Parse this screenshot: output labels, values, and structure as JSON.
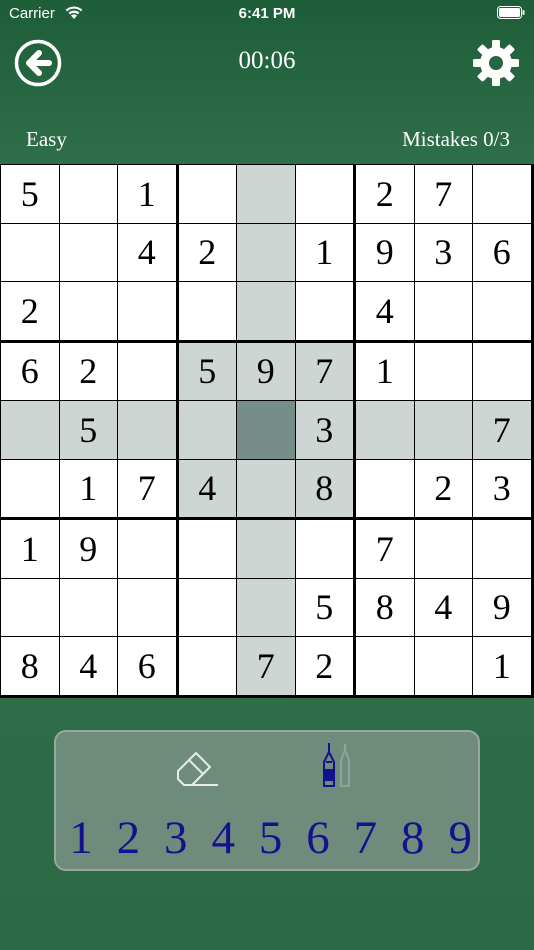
{
  "status_bar": {
    "carrier": "Carrier",
    "time": "6:41 PM"
  },
  "header": {
    "timer": "00:06",
    "back_icon": "arrow-left-icon",
    "settings_icon": "gear-icon"
  },
  "info": {
    "difficulty": "Easy",
    "mistakes": "Mistakes 0/3"
  },
  "board": {
    "selected": {
      "row": 4,
      "col": 4
    },
    "grid": [
      [
        "5",
        "",
        "1",
        "",
        "",
        "",
        "2",
        "7",
        ""
      ],
      [
        "",
        "",
        "4",
        "2",
        "",
        "1",
        "9",
        "3",
        "6"
      ],
      [
        "2",
        "",
        "",
        "",
        "",
        "",
        "4",
        "",
        ""
      ],
      [
        "6",
        "2",
        "",
        "5",
        "9",
        "7",
        "1",
        "",
        ""
      ],
      [
        "",
        "5",
        "",
        "",
        "",
        "3",
        "",
        "",
        "7"
      ],
      [
        "",
        "1",
        "7",
        "4",
        "",
        "8",
        "",
        "2",
        "3"
      ],
      [
        "1",
        "9",
        "",
        "",
        "",
        "",
        "7",
        "",
        ""
      ],
      [
        "",
        "",
        "",
        "",
        "",
        "5",
        "8",
        "4",
        "9"
      ],
      [
        "8",
        "4",
        "6",
        "",
        "7",
        "2",
        "",
        "",
        "1"
      ]
    ]
  },
  "colors": {
    "cell": "#ffffff",
    "highlight": "#cdd6d3",
    "selected": "#758e89",
    "digit": "#000000",
    "pad_digit": "#13128c"
  },
  "toolbar": {
    "eraser_icon": "eraser-icon",
    "pencil_icon": "pencil-notes-icon",
    "numbers": [
      "1",
      "2",
      "3",
      "4",
      "5",
      "6",
      "7",
      "8",
      "9"
    ]
  }
}
